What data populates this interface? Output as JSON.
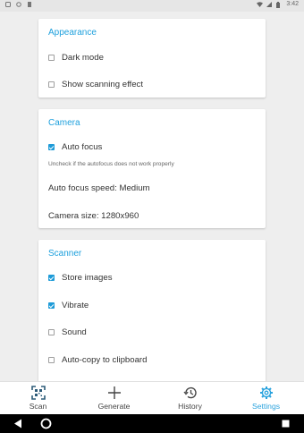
{
  "statusbar": {
    "time": "3:42"
  },
  "appearance": {
    "title": "Appearance",
    "dark_mode": "Dark mode",
    "scan_effect": "Show scanning effect"
  },
  "camera": {
    "title": "Camera",
    "auto_focus": "Auto focus",
    "hint": "Uncheck if the autofocus does not work properly",
    "speed": "Auto focus speed: Medium",
    "size": "Camera size: 1280x960"
  },
  "scanner": {
    "title": "Scanner",
    "store_images": "Store images",
    "vibrate": "Vibrate",
    "sound": "Sound",
    "auto_copy": "Auto-copy to clipboard"
  },
  "nav": {
    "scan": "Scan",
    "generate": "Generate",
    "history": "History",
    "settings": "Settings"
  },
  "colors": {
    "accent": "#1ea0dd",
    "background": "#eeeeee"
  }
}
